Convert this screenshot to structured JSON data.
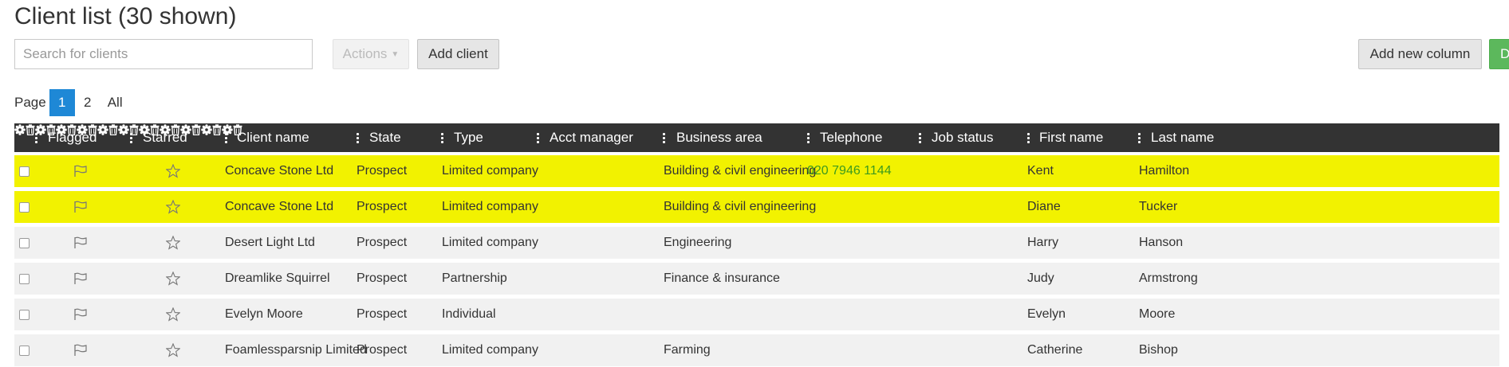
{
  "page": {
    "title": "Client list (30 shown)",
    "search_placeholder": "Search for clients",
    "actions_label": "Actions",
    "add_client_label": "Add client",
    "add_column_label": "Add new column",
    "green_button_label": "D"
  },
  "pagination": {
    "label": "Page",
    "pages": [
      "1",
      "2",
      "All"
    ],
    "current": "1"
  },
  "columns": [
    "Flagged",
    "Starred",
    "Client name",
    "State",
    "Type",
    "Acct manager",
    "Business area",
    "Telephone",
    "Job status",
    "First name",
    "Last name"
  ],
  "icons": {
    "column_menu": "vertical-dots-icon",
    "column_settings": "gear-icon",
    "column_delete": "trash-icon",
    "flag": "flag-icon",
    "star": "star-icon"
  },
  "colors": {
    "highlight_row": "#f2f200",
    "header_bg": "#333333",
    "active_page": "#1e88d6",
    "telephone_text": "#3c9a1e"
  },
  "rows": [
    {
      "highlighted": true,
      "client_name": "Concave Stone Ltd",
      "state": "Prospect",
      "type": "Limited company",
      "acct_manager": "",
      "business_area": "Building & civil engineering",
      "telephone": "020 7946 1144",
      "job_status": "",
      "first_name": "Kent",
      "last_name": "Hamilton"
    },
    {
      "highlighted": true,
      "client_name": "Concave Stone Ltd",
      "state": "Prospect",
      "type": "Limited company",
      "acct_manager": "",
      "business_area": "Building & civil engineering",
      "telephone": "",
      "job_status": "",
      "first_name": "Diane",
      "last_name": "Tucker"
    },
    {
      "highlighted": false,
      "client_name": "Desert Light Ltd",
      "state": "Prospect",
      "type": "Limited company",
      "acct_manager": "",
      "business_area": "Engineering",
      "telephone": "",
      "job_status": "",
      "first_name": "Harry",
      "last_name": "Hanson"
    },
    {
      "highlighted": false,
      "client_name": "Dreamlike Squirrel",
      "state": "Prospect",
      "type": "Partnership",
      "acct_manager": "",
      "business_area": "Finance & insurance",
      "telephone": "",
      "job_status": "",
      "first_name": "Judy",
      "last_name": "Armstrong"
    },
    {
      "highlighted": false,
      "client_name": "Evelyn Moore",
      "state": "Prospect",
      "type": "Individual",
      "acct_manager": "",
      "business_area": "",
      "telephone": "",
      "job_status": "",
      "first_name": "Evelyn",
      "last_name": "Moore"
    },
    {
      "highlighted": false,
      "client_name": "Foamlessparsnip Limited",
      "state": "Prospect",
      "type": "Limited company",
      "acct_manager": "",
      "business_area": "Farming",
      "telephone": "",
      "job_status": "",
      "first_name": "Catherine",
      "last_name": "Bishop"
    }
  ]
}
